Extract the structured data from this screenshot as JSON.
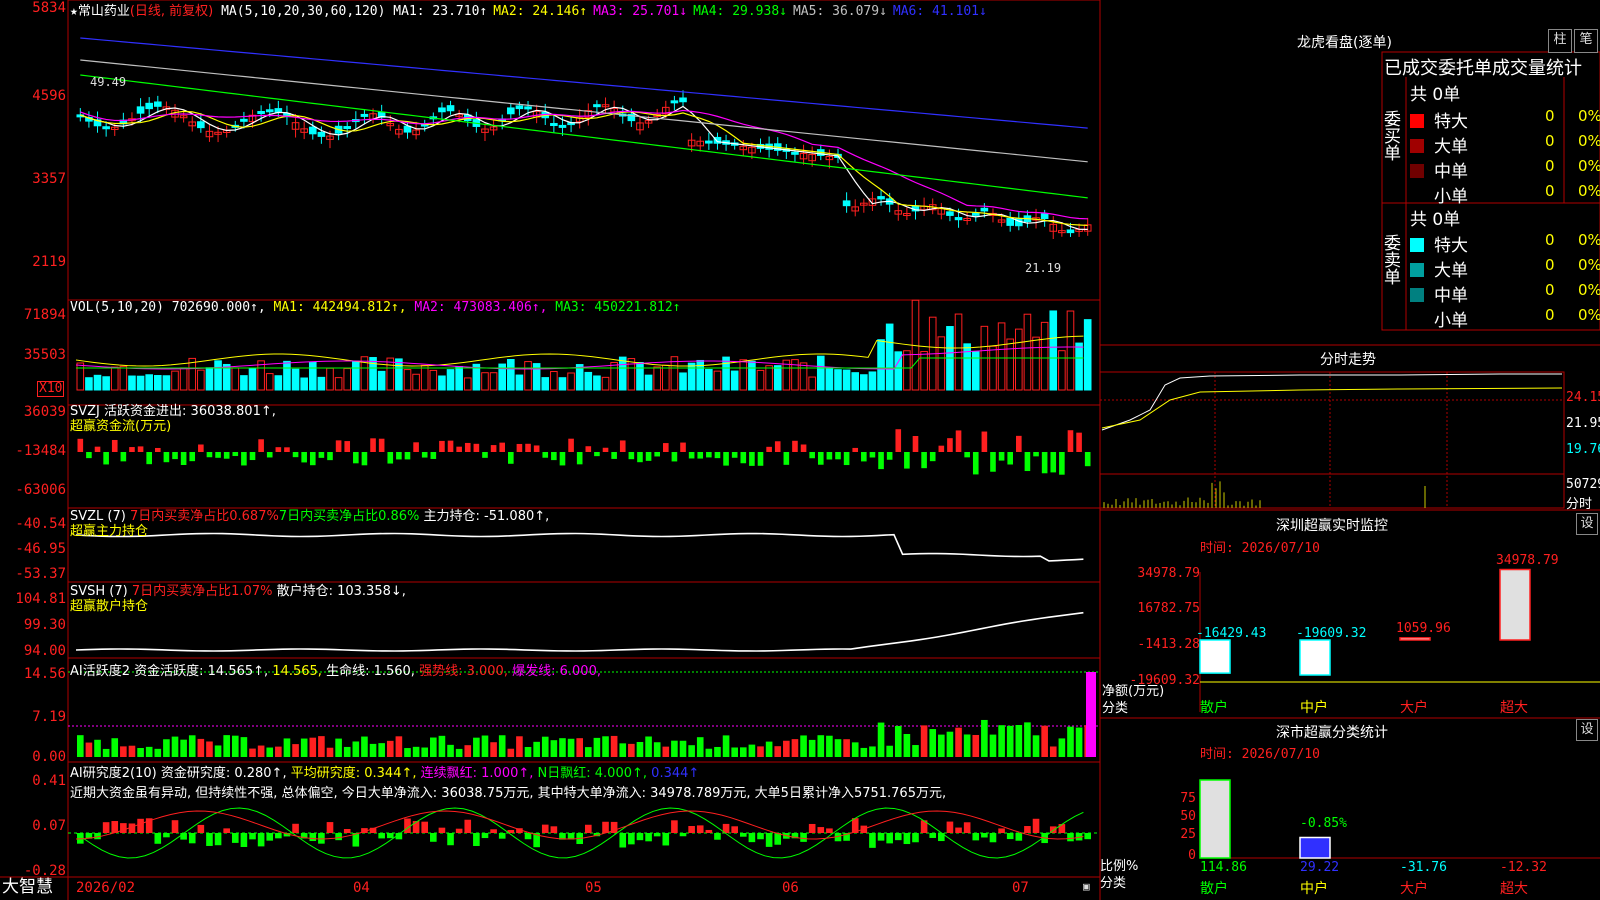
{
  "main": {
    "star": "★",
    "stock_name": "常山药业",
    "period": "(日线, 前复权)",
    "ma_label": "MA(5,10,20,30,60,120)",
    "ma_values": [
      {
        "label": "MA1:",
        "value": "23.710↑",
        "color": "#ffffff"
      },
      {
        "label": "MA2:",
        "value": "24.146↑",
        "color": "#ffff00"
      },
      {
        "label": "MA3:",
        "value": "25.701↓",
        "color": "#ff00ff"
      },
      {
        "label": "MA4:",
        "value": "29.938↓",
        "color": "#00ff00"
      },
      {
        "label": "MA5:",
        "value": "36.079↓",
        "color": "#c0c0c0"
      },
      {
        "label": "MA6:",
        "value": "41.101↓",
        "color": "#3030ff"
      }
    ],
    "y_ticks": [
      "5834",
      "4596",
      "3357",
      "2119"
    ],
    "high_mark": "49.49",
    "low_mark": "21.19"
  },
  "vol": {
    "label": "VOL(5,10,20)",
    "value": "702690.000↑,",
    "ma1": "MA1: 442494.812↑,",
    "ma2": "MA2: 473083.406↑,",
    "ma3": "MA3: 450221.812↑",
    "y_ticks": [
      "71894",
      "35503"
    ],
    "unit": "X10"
  },
  "svzj": {
    "label": "SVZJ",
    "line1": "活跃资金进出: 36038.801↑,",
    "line2": "超赢资金流(万元)",
    "y_ticks": [
      "36039",
      "-13484",
      "-63006"
    ]
  },
  "svzl": {
    "label": "SVZL (7)",
    "t1": "7日内买卖净占比0.687%",
    "t2": "7日内买卖净占比0.86%",
    "t3": "主力持仓: -51.080↑,",
    "line2": "超赢主力持仓",
    "y_ticks": [
      "-40.54",
      "-46.95",
      "-53.37"
    ]
  },
  "svsh": {
    "label": "SVSH (7)",
    "t1": "7日内买卖净占比1.07%",
    "t2": "散户持仓: 103.358↓,",
    "line2": "超赢散户持仓",
    "y_ticks": [
      "104.81",
      "99.30",
      "94.00"
    ]
  },
  "ai1": {
    "label": "AI活跃度2",
    "t1": "资金活跃度: 14.565↑,",
    "t2": "14.565,",
    "t3": "生命线: 1.560,",
    "t4": "强势线: 3.000,",
    "t5": "爆发线: 6.000,",
    "y_ticks": [
      "14.56",
      "7.19",
      "0.00"
    ]
  },
  "ai2": {
    "label": "AI研究度2(10)",
    "t1": "资金研究度: 0.280↑,",
    "t2": "平均研究度: 0.344↑,",
    "t3": "连续飘红: 1.000↑,",
    "t4": "N日飘红: 4.000↑,",
    "t5": "0.344↑",
    "comment": "近期大资金虽有异动, 但持续性不强, 总体偏空, 今日大单净流入: 36038.75万元, 其中特大单净流入: 34978.789万元, 大单5日累计净入5751.765万元,",
    "y_ticks": [
      "0.41",
      "0.07",
      "-0.28"
    ]
  },
  "bottom": {
    "logo": "大智慧",
    "dates": [
      "2026/02",
      "04",
      "05",
      "06",
      "07"
    ]
  },
  "dragon": {
    "title": "龙虎看盘(逐单)",
    "btn_bar": "柱",
    "btn_pen": "笔",
    "header": "已成交委托单成交量统计",
    "buy_label": "委买单",
    "sell_label": "委卖单",
    "buy_total": "共 0单",
    "sell_total": "共 0单",
    "buy_rows": [
      {
        "name": "特大",
        "n": "0",
        "pct": "0%",
        "color": "#ff0000"
      },
      {
        "name": "大单",
        "n": "0",
        "pct": "0%",
        "color": "#a00000"
      },
      {
        "name": "中单",
        "n": "0",
        "pct": "0%",
        "color": "#700000"
      },
      {
        "name": "小单",
        "n": "0",
        "pct": "0%",
        "color": ""
      }
    ],
    "sell_rows": [
      {
        "name": "特大",
        "n": "0",
        "pct": "0%",
        "color": "#00ffff"
      },
      {
        "name": "大单",
        "n": "0",
        "pct": "0%",
        "color": "#00a0a0"
      },
      {
        "name": "中单",
        "n": "0",
        "pct": "0%",
        "color": "#008080"
      },
      {
        "name": "小单",
        "n": "0",
        "pct": "0%",
        "color": ""
      }
    ]
  },
  "intraday": {
    "title": "分时走势",
    "prices": [
      "24.15",
      "21.95",
      "19.76"
    ],
    "vol": "50729",
    "vol_unit": "分时"
  },
  "monitor": {
    "title": "深圳超赢实时监控",
    "settings": "设",
    "time": "时间: 2026/07/10",
    "y_ticks": [
      "34978.79",
      "16782.75",
      "-1413.28",
      "-19609.32"
    ],
    "axis_label_1": "净额(万元)",
    "axis_label_2": "分类",
    "categories": [
      "散户",
      "中户",
      "大户",
      "超大"
    ],
    "values": [
      -16429.43,
      -19609.32,
      1059.96,
      34978.79
    ],
    "value_labels": [
      "-16429.43",
      "-19609.32",
      "1059.96",
      "34978.79"
    ]
  },
  "stats": {
    "title": "深市超赢分类统计",
    "settings": "设",
    "time": "时间: 2026/07/10",
    "y_ticks": [
      "75",
      "50",
      "25",
      "0"
    ],
    "axis_label_1": "比例%",
    "axis_label_2": "分类",
    "categories": [
      "散户",
      "中户",
      "大户",
      "超大"
    ],
    "values": [
      114.86,
      29.22,
      -31.76,
      -12.32
    ],
    "value_labels": [
      "114.86",
      "29.22",
      "-31.76",
      "-12.32"
    ],
    "annotation": "-0.85%"
  },
  "colors": {
    "up": "#ff0000",
    "down": "#00ffff",
    "grid_red": "#a00000",
    "axis_text": "#ff4040",
    "yellow": "#ffff00",
    "magenta": "#ff00ff",
    "green": "#00ff00"
  }
}
